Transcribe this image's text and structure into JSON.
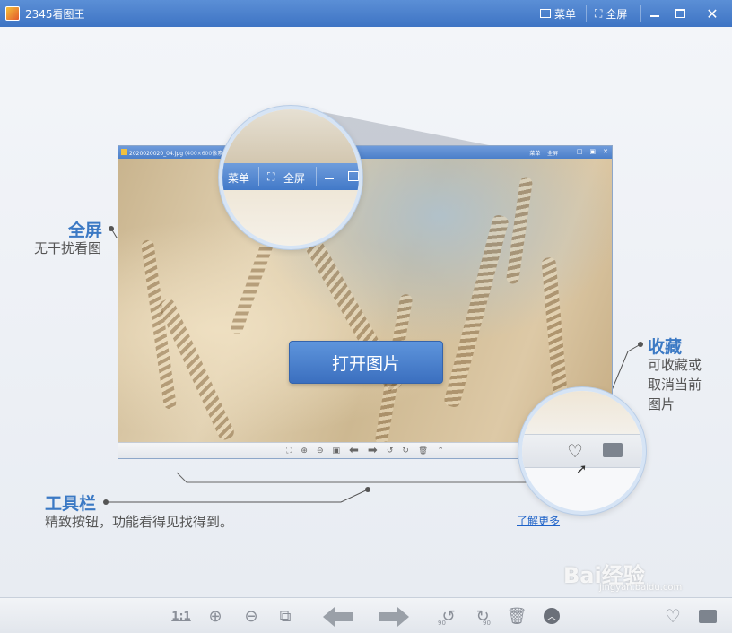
{
  "app": {
    "title": "2345看图王"
  },
  "titlebar": {
    "menu_label": "菜单",
    "fullscreen_label": "全屏"
  },
  "preview": {
    "title": "2020020020_04.jpg",
    "title_extra": "(400×600像素 -",
    "menu_label": "菜单",
    "fullscreen_label": "全屏"
  },
  "open_button": {
    "label": "打开图片"
  },
  "magnifier_top": {
    "menu_label": "菜单",
    "fullscreen_label": "全屏"
  },
  "callouts": {
    "fullscreen": {
      "title": "全屏",
      "desc": "无干扰看图"
    },
    "favorite": {
      "title": "收藏",
      "desc_lines": [
        "可收藏或",
        "取消当前",
        "图片"
      ]
    },
    "toolbar": {
      "title": "工具栏",
      "desc": "精致按钮，功能看得见找得到。"
    }
  },
  "link": {
    "label": "了解更多"
  },
  "bottom_toolbar": {
    "actual_size_label": "1:1",
    "rotate_left_label": "90",
    "rotate_right_label": "90"
  },
  "watermark": {
    "text": "Bai经验",
    "sub": "jingyan.baidu.com"
  },
  "colors": {
    "titlebar": "#4a80ca",
    "accent": "#3b79c4",
    "open_button": "#4a82cf"
  }
}
